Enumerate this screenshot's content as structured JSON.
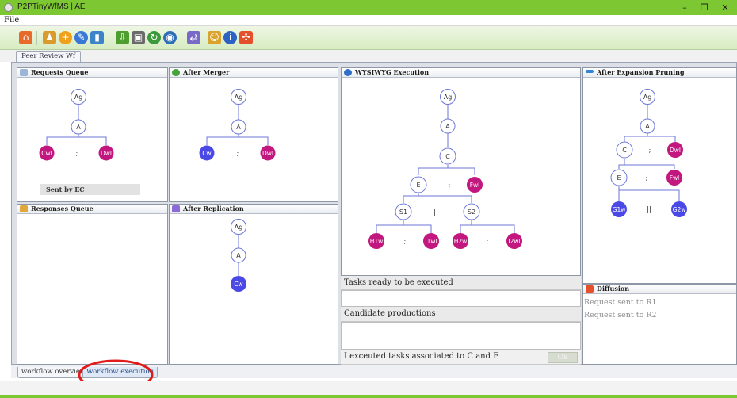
{
  "window": {
    "title": "P2PTinyWfMS | AE",
    "controls": {
      "minimize": "–",
      "maximize": "❐",
      "close": "✕"
    }
  },
  "menu": {
    "file": "File"
  },
  "toolbar": {
    "icons": [
      "home-icon",
      "users-icon",
      "add-icon",
      "edit-icon",
      "delete-icon",
      "download-icon",
      "save-icon",
      "refresh-icon",
      "globe-icon",
      "network-icon",
      "peer-icon",
      "info-icon",
      "expand-icon"
    ]
  },
  "tabs": {
    "active": "Peer Review Wf"
  },
  "panels": {
    "requests_queue": {
      "title": "Requests Queue",
      "sent_label": "Sent by EC"
    },
    "after_merger": {
      "title": "After Merger"
    },
    "wysiwyg": {
      "title": "WYSIWYG Execution"
    },
    "after_pruning": {
      "title": "After Expansion Pruning"
    },
    "responses_queue": {
      "title": "Responses Queue"
    },
    "after_replication": {
      "title": "After Replication"
    },
    "diffusion": {
      "title": "Diffusion",
      "items": [
        "Request sent to  R1",
        "Request sent to  R2"
      ]
    }
  },
  "execution": {
    "tasks_ready_label": "Tasks ready to be executed",
    "tasks_ready_value": "",
    "candidate_label": "Candidate productions",
    "candidate_value": "",
    "executed_msg": "I exceuted tasks associated to C and E",
    "ok_label": "Ok"
  },
  "trees": {
    "requests": {
      "nodes": {
        "ag": "Ag",
        "a": "A",
        "l": "Cwl",
        "r": "Dwl"
      },
      "sep": ";"
    },
    "merger": {
      "nodes": {
        "ag": "Ag",
        "a": "A",
        "l": "Cw",
        "r": "Dwl"
      },
      "sep": ";"
    },
    "replication": {
      "nodes": {
        "ag": "Ag",
        "a": "A",
        "c": "Cw"
      }
    },
    "wysiwyg": {
      "nodes": {
        "ag": "Ag",
        "a": "A",
        "c": "C",
        "e": "E",
        "fwl": "Fwl",
        "s1": "S1",
        "s2": "S2",
        "h1": "H1w",
        "i1": "I1wl",
        "h2": "H2w",
        "i2": "I2wl"
      },
      "seps": {
        "e_f": ";",
        "par": "||",
        "h1_i1": ";",
        "h2_i2": ";"
      }
    },
    "pruning": {
      "nodes": {
        "ag": "Ag",
        "a": "A",
        "c": "C",
        "dwl": "Dwl",
        "e": "E",
        "fwl": "Fwl",
        "g1": "G1w",
        "g2": "G2w"
      },
      "seps": {
        "c_d": ";",
        "e_f": ";",
        "par": "||"
      }
    }
  },
  "bottom_tabs": {
    "overview": "workflow overview",
    "execution": "Workflow execution"
  },
  "colors": {
    "titlebar": "#7dc832",
    "node_outline": "#6b76d6",
    "node_blue": "#4b49e6",
    "node_magenta": "#c1177e",
    "annotation": "#e11b1b"
  }
}
